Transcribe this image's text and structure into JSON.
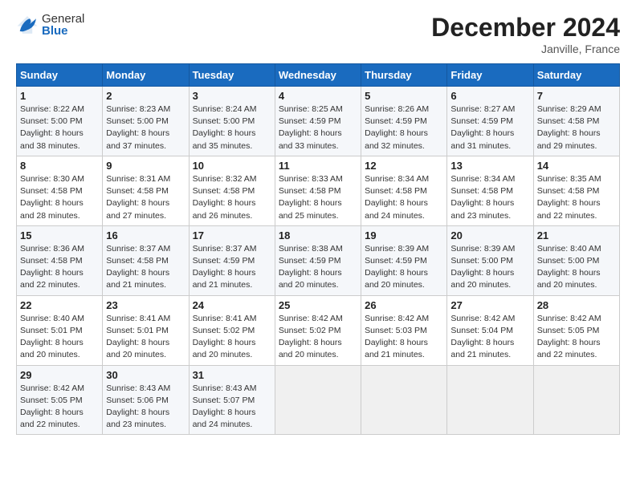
{
  "header": {
    "logo_general": "General",
    "logo_blue": "Blue",
    "title": "December 2024",
    "subtitle": "Janville, France"
  },
  "weekdays": [
    "Sunday",
    "Monday",
    "Tuesday",
    "Wednesday",
    "Thursday",
    "Friday",
    "Saturday"
  ],
  "weeks": [
    [
      {
        "day": "1",
        "sunrise": "8:22 AM",
        "sunset": "5:00 PM",
        "daylight": "8 hours and 38 minutes."
      },
      {
        "day": "2",
        "sunrise": "8:23 AM",
        "sunset": "5:00 PM",
        "daylight": "8 hours and 37 minutes."
      },
      {
        "day": "3",
        "sunrise": "8:24 AM",
        "sunset": "5:00 PM",
        "daylight": "8 hours and 35 minutes."
      },
      {
        "day": "4",
        "sunrise": "8:25 AM",
        "sunset": "4:59 PM",
        "daylight": "8 hours and 33 minutes."
      },
      {
        "day": "5",
        "sunrise": "8:26 AM",
        "sunset": "4:59 PM",
        "daylight": "8 hours and 32 minutes."
      },
      {
        "day": "6",
        "sunrise": "8:27 AM",
        "sunset": "4:59 PM",
        "daylight": "8 hours and 31 minutes."
      },
      {
        "day": "7",
        "sunrise": "8:29 AM",
        "sunset": "4:58 PM",
        "daylight": "8 hours and 29 minutes."
      }
    ],
    [
      {
        "day": "8",
        "sunrise": "8:30 AM",
        "sunset": "4:58 PM",
        "daylight": "8 hours and 28 minutes."
      },
      {
        "day": "9",
        "sunrise": "8:31 AM",
        "sunset": "4:58 PM",
        "daylight": "8 hours and 27 minutes."
      },
      {
        "day": "10",
        "sunrise": "8:32 AM",
        "sunset": "4:58 PM",
        "daylight": "8 hours and 26 minutes."
      },
      {
        "day": "11",
        "sunrise": "8:33 AM",
        "sunset": "4:58 PM",
        "daylight": "8 hours and 25 minutes."
      },
      {
        "day": "12",
        "sunrise": "8:34 AM",
        "sunset": "4:58 PM",
        "daylight": "8 hours and 24 minutes."
      },
      {
        "day": "13",
        "sunrise": "8:34 AM",
        "sunset": "4:58 PM",
        "daylight": "8 hours and 23 minutes."
      },
      {
        "day": "14",
        "sunrise": "8:35 AM",
        "sunset": "4:58 PM",
        "daylight": "8 hours and 22 minutes."
      }
    ],
    [
      {
        "day": "15",
        "sunrise": "8:36 AM",
        "sunset": "4:58 PM",
        "daylight": "8 hours and 22 minutes."
      },
      {
        "day": "16",
        "sunrise": "8:37 AM",
        "sunset": "4:58 PM",
        "daylight": "8 hours and 21 minutes."
      },
      {
        "day": "17",
        "sunrise": "8:37 AM",
        "sunset": "4:59 PM",
        "daylight": "8 hours and 21 minutes."
      },
      {
        "day": "18",
        "sunrise": "8:38 AM",
        "sunset": "4:59 PM",
        "daylight": "8 hours and 20 minutes."
      },
      {
        "day": "19",
        "sunrise": "8:39 AM",
        "sunset": "4:59 PM",
        "daylight": "8 hours and 20 minutes."
      },
      {
        "day": "20",
        "sunrise": "8:39 AM",
        "sunset": "5:00 PM",
        "daylight": "8 hours and 20 minutes."
      },
      {
        "day": "21",
        "sunrise": "8:40 AM",
        "sunset": "5:00 PM",
        "daylight": "8 hours and 20 minutes."
      }
    ],
    [
      {
        "day": "22",
        "sunrise": "8:40 AM",
        "sunset": "5:01 PM",
        "daylight": "8 hours and 20 minutes."
      },
      {
        "day": "23",
        "sunrise": "8:41 AM",
        "sunset": "5:01 PM",
        "daylight": "8 hours and 20 minutes."
      },
      {
        "day": "24",
        "sunrise": "8:41 AM",
        "sunset": "5:02 PM",
        "daylight": "8 hours and 20 minutes."
      },
      {
        "day": "25",
        "sunrise": "8:42 AM",
        "sunset": "5:02 PM",
        "daylight": "8 hours and 20 minutes."
      },
      {
        "day": "26",
        "sunrise": "8:42 AM",
        "sunset": "5:03 PM",
        "daylight": "8 hours and 21 minutes."
      },
      {
        "day": "27",
        "sunrise": "8:42 AM",
        "sunset": "5:04 PM",
        "daylight": "8 hours and 21 minutes."
      },
      {
        "day": "28",
        "sunrise": "8:42 AM",
        "sunset": "5:05 PM",
        "daylight": "8 hours and 22 minutes."
      }
    ],
    [
      {
        "day": "29",
        "sunrise": "8:42 AM",
        "sunset": "5:05 PM",
        "daylight": "8 hours and 22 minutes."
      },
      {
        "day": "30",
        "sunrise": "8:43 AM",
        "sunset": "5:06 PM",
        "daylight": "8 hours and 23 minutes."
      },
      {
        "day": "31",
        "sunrise": "8:43 AM",
        "sunset": "5:07 PM",
        "daylight": "8 hours and 24 minutes."
      },
      null,
      null,
      null,
      null
    ]
  ],
  "labels": {
    "sunrise": "Sunrise:",
    "sunset": "Sunset:",
    "daylight": "Daylight:"
  }
}
